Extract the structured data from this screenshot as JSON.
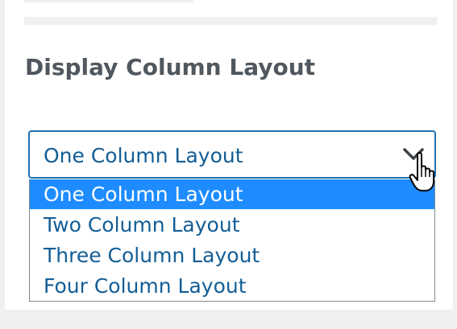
{
  "section": {
    "heading": "Display Column Layout"
  },
  "layout_select": {
    "selected_value": "One Column Layout",
    "options": [
      {
        "label": "One Column Layout",
        "selected": true
      },
      {
        "label": "Two Column Layout",
        "selected": false
      },
      {
        "label": "Three Column Layout",
        "selected": false
      },
      {
        "label": "Four Column Layout",
        "selected": false
      }
    ]
  },
  "icons": {
    "chevron": "chevron-down-icon",
    "cursor": "hand-pointer-icon"
  },
  "colors": {
    "accent_border": "#2271b1",
    "option_text": "#135e96",
    "selected_bg": "#1e8cff",
    "heading_text": "#50575e",
    "background": "#f0f0f1"
  }
}
